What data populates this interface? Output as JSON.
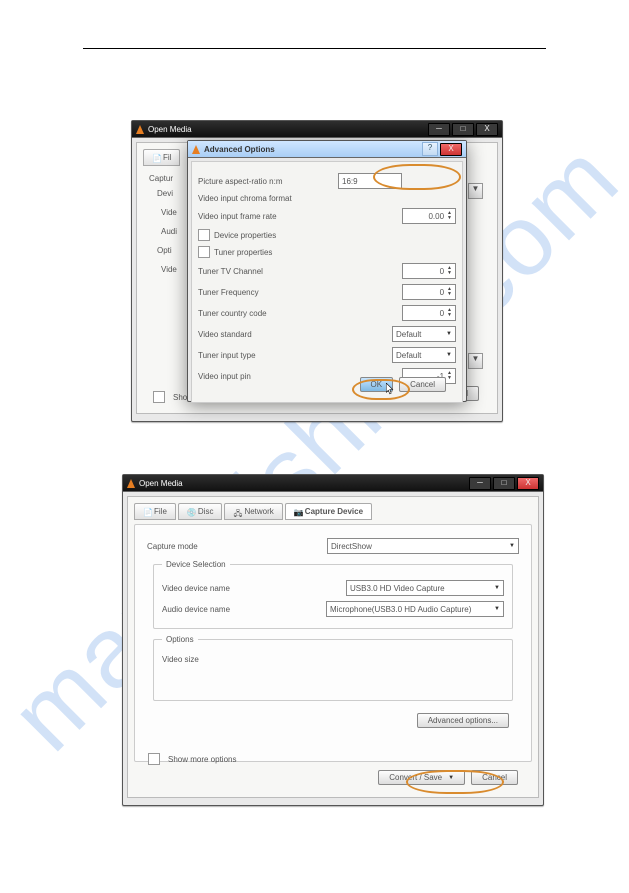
{
  "watermark": "manualshive.com",
  "top_window": {
    "title": "Open Media",
    "left_labels": [
      "Captur",
      "Devi",
      "Vide",
      "Audi",
      "Opti",
      "Vide"
    ],
    "show_more": "Show",
    "back_dropdown": "",
    "bottom_right_btn": "..ncel"
  },
  "advanced": {
    "title": "Advanced Options",
    "rows": {
      "aspect_ratio_lbl": "Picture aspect-ratio n:m",
      "aspect_ratio_val": "16:9",
      "chroma_lbl": "Video input chroma format",
      "framerate_lbl": "Video input frame rate",
      "framerate_val": "0.00",
      "dev_props": "Device properties",
      "tuner_props": "Tuner properties",
      "tuner_channel_lbl": "Tuner TV Channel",
      "tuner_channel_val": "0",
      "tuner_freq_lbl": "Tuner Frequency",
      "tuner_freq_val": "0",
      "tuner_country_lbl": "Tuner country code",
      "tuner_country_val": "0",
      "video_std_lbl": "Video standard",
      "video_std_val": "Default",
      "tuner_input_lbl": "Tuner input type",
      "tuner_input_val": "Default",
      "video_pin_lbl": "Video input pin",
      "video_pin_val": "-1"
    },
    "ok": "OK",
    "cancel": "Cancel"
  },
  "bottom_window": {
    "title": "Open Media",
    "tabs": {
      "file": "File",
      "disc": "Disc",
      "network": "Network",
      "capture": "Capture Device"
    },
    "capture_mode_lbl": "Capture mode",
    "capture_mode_val": "DirectShow",
    "dev_sel_legend": "Device Selection",
    "video_dev_lbl": "Video device name",
    "video_dev_val": "USB3.0 HD Video Capture",
    "audio_dev_lbl": "Audio device name",
    "audio_dev_val": "Microphone(USB3.0 HD Audio Capture)",
    "options_legend": "Options",
    "video_size_lbl": "Video size",
    "adv_opts_btn": "Advanced options...",
    "show_more": "Show more options",
    "convert_btn": "Convert / Save",
    "cancel": "Cancel"
  }
}
